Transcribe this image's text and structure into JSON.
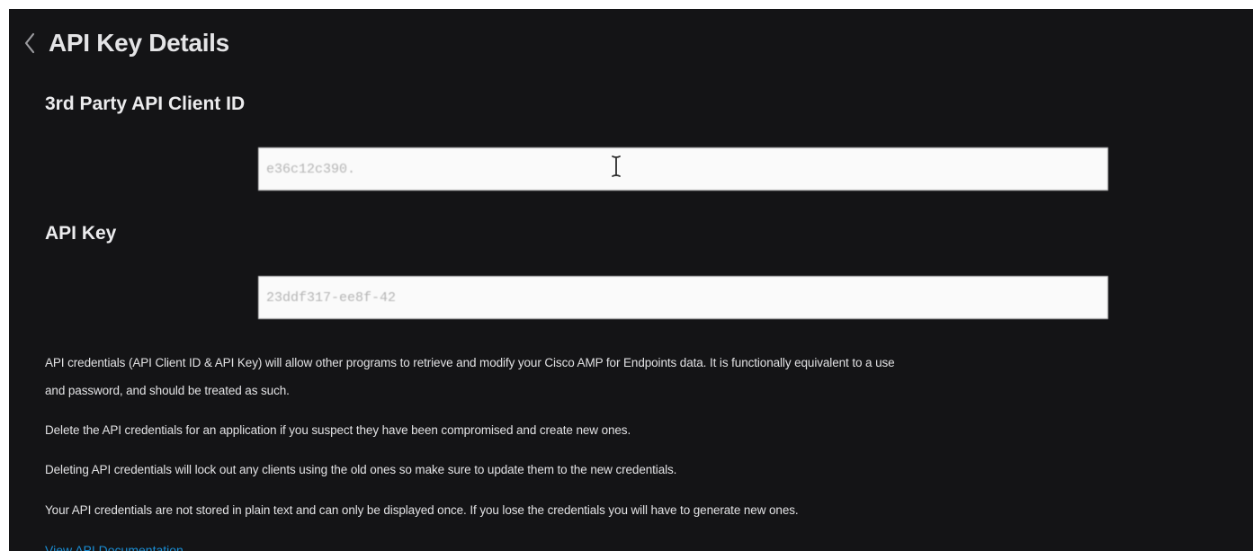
{
  "header": {
    "back_icon": "chevron-left-icon",
    "title": "API Key Details"
  },
  "client_id": {
    "label": "3rd Party API Client ID",
    "value": "e36c12c390."
  },
  "api_key": {
    "label": "API Key",
    "value": "23ddf317-ee8f-42"
  },
  "description": {
    "line1": "API credentials (API Client ID & API Key) will allow other programs to retrieve and modify your Cisco AMP for Endpoints data. It is functionally equivalent to a use",
    "line2": "and password, and should be treated as such.",
    "line3": "Delete the API credentials for an application if you suspect they have been compromised and create new ones.",
    "line4": "Deleting API credentials will lock out any clients using the old ones so make sure to update them to the new credentials.",
    "line5": "Your API credentials are not stored in plain text and can only be displayed once. If you lose the credentials you will have to generate new ones."
  },
  "links": {
    "documentation": "View API Documentation"
  },
  "colors": {
    "panel_bg": "#141416",
    "text": "#e2e2e4",
    "link": "#1a8fd6",
    "field_bg": "#fafafa"
  },
  "icons": {
    "text_cursor": "text-cursor-icon"
  }
}
